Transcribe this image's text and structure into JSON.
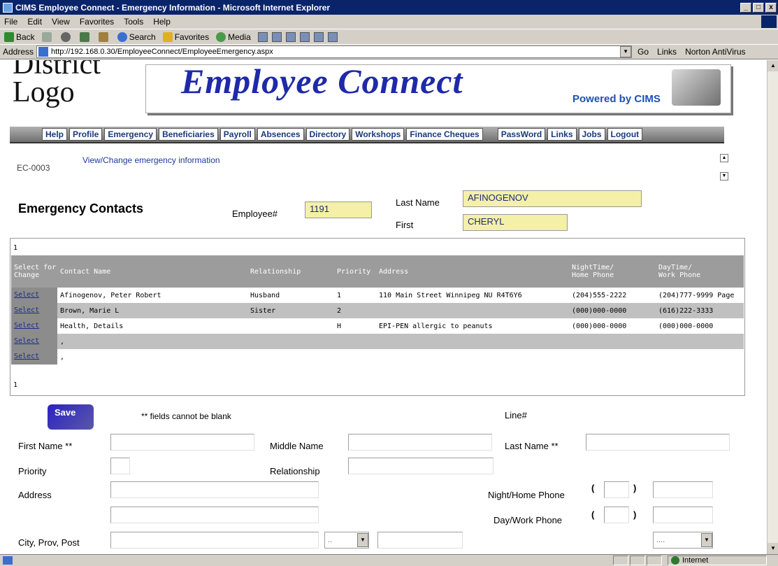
{
  "window": {
    "title": "CIMS Employee Connect - Emergency Information - Microsoft Internet Explorer",
    "controls": [
      "_",
      "□",
      "x"
    ]
  },
  "menu": [
    "File",
    "Edit",
    "View",
    "Favorites",
    "Tools",
    "Help"
  ],
  "toolbar": {
    "back": "Back",
    "search": "Search",
    "favorites": "Favorites",
    "media": "Media"
  },
  "address": {
    "label": "Address",
    "url": "http://192.168.0.30/EmployeeConnect/EmployeeEmergency.aspx",
    "go": "Go",
    "links": "Links",
    "norton": "Norton AntiVirus"
  },
  "banner": {
    "logo_line1": "District",
    "logo_line2": "Logo",
    "title": "Employee Connect",
    "powered": "Powered by CIMS"
  },
  "nav": [
    "Help",
    "Profile",
    "Emergency",
    "Beneficiaries",
    "Payroll",
    "Absences",
    "Directory",
    "Workshops",
    "Finance Cheques",
    "PassWord",
    "Links",
    "Jobs",
    "Logout"
  ],
  "page": {
    "code": "EC-0003",
    "subtitle": "View/Change emergency information",
    "heading": "Emergency Contacts"
  },
  "employee": {
    "number_label": "Employee#",
    "number": "1191",
    "last_label": "Last Name",
    "last": "AFINOGENOV",
    "first_label": "First",
    "first": "CHERYL"
  },
  "grid": {
    "pager_top": "1",
    "pager_bottom": "1",
    "headers": {
      "select_l1": "Select for",
      "select_l2": "Change",
      "name": "Contact Name",
      "relationship": "Relationship",
      "priority": "Priority",
      "address": "Address",
      "night_l1": "NightTime/",
      "night_l2": "Home Phone",
      "day_l1": "DayTime/",
      "day_l2": "Work Phone"
    },
    "rows": [
      {
        "select": "Select",
        "name": "Afinogenov, Peter Robert",
        "relationship": "Husband",
        "priority": "1",
        "address": "110 Main Street Winnipeg NU R4T6Y6",
        "night": "(204)555-2222",
        "day": "(204)777-9999 Page"
      },
      {
        "select": "Select",
        "name": "Brown, Marie L",
        "relationship": "Sister",
        "priority": "2",
        "address": "",
        "night": "(000)000-0000",
        "day": "(616)222-3333"
      },
      {
        "select": "Select",
        "name": "Health, Details",
        "relationship": "",
        "priority": "H",
        "address": "EPI-PEN allergic to peanuts",
        "night": "(000)000-0000",
        "day": "(000)000-0000"
      },
      {
        "select": "Select",
        "name": ",",
        "relationship": "",
        "priority": "",
        "address": "",
        "night": "",
        "day": ""
      },
      {
        "select": "Select",
        "name": ",",
        "relationship": "",
        "priority": "",
        "address": "",
        "night": "",
        "day": ""
      }
    ]
  },
  "form": {
    "save": "Save",
    "hint": "** fields cannot be blank",
    "line_label": "Line#",
    "first_label": "First Name **",
    "middle_label": "Middle Name",
    "last_label": "Last Name **",
    "priority_label": "Priority",
    "relationship_label": "Relationship",
    "address_label": "Address",
    "night_label": "Night/Home Phone",
    "day_label": "Day/Work Phone",
    "city_label": "City, Prov, Post",
    "prov_selected": "..",
    "country_selected": "...."
  },
  "status": {
    "zone": "Internet"
  }
}
